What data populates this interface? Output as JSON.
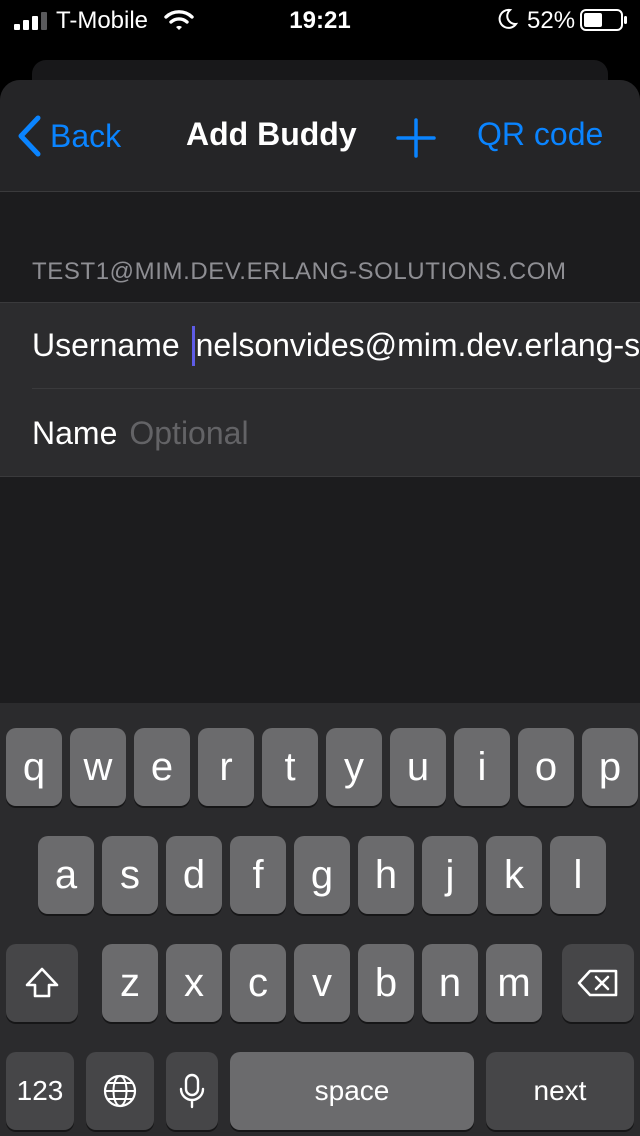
{
  "status_bar": {
    "carrier": "T-Mobile",
    "time": "19:21",
    "battery_percent": "52%",
    "battery_level": 0.52,
    "icons": [
      "signal-icon",
      "wifi-icon",
      "moon-icon",
      "battery-icon"
    ]
  },
  "nav": {
    "back_label": "Back",
    "title": "Add Buddy",
    "qr_label": "QR code",
    "plus_icon": "plus-icon"
  },
  "form": {
    "section_header": "TEST1@MIM.DEV.ERLANG-SOLUTIONS.COM",
    "username_label": "Username",
    "username_value": "nelsonvides@mim.dev.erlang-solutions.com",
    "name_label": "Name",
    "name_placeholder": "Optional"
  },
  "keyboard": {
    "row1": [
      "q",
      "w",
      "e",
      "r",
      "t",
      "y",
      "u",
      "i",
      "o",
      "p"
    ],
    "row2": [
      "a",
      "s",
      "d",
      "f",
      "g",
      "h",
      "j",
      "k",
      "l"
    ],
    "row3": [
      "z",
      "x",
      "c",
      "v",
      "b",
      "n",
      "m"
    ],
    "numbers_label": "123",
    "space_label": "space",
    "next_label": "next",
    "icons": [
      "shift-icon",
      "backspace-icon",
      "globe-icon",
      "microphone-icon"
    ]
  },
  "colors": {
    "accent": "#0a84ff",
    "background": "#1c1c1e",
    "cell": "#2c2c2e",
    "caret": "#5e5ce6"
  }
}
